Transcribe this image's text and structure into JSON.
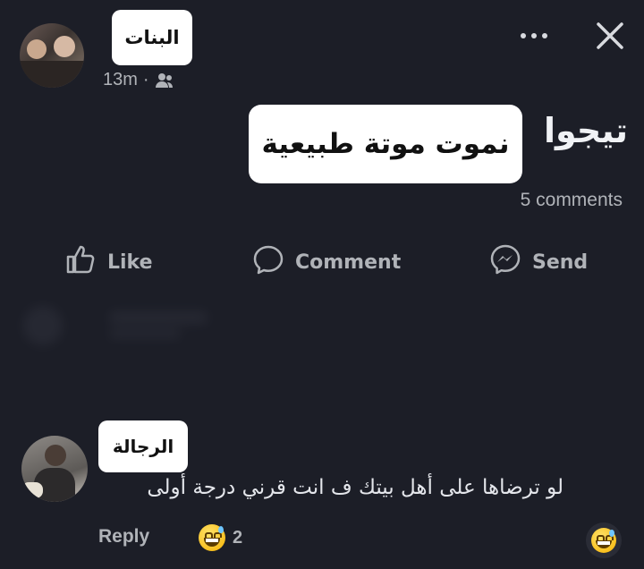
{
  "post": {
    "author_label": "البنات",
    "time": "13m",
    "separator": "·",
    "audience_icon": "friends-icon",
    "body_prefix": "تيجوا",
    "body_highlight": "نموت موتة طبيعية",
    "comments_count": "5 comments"
  },
  "header": {
    "more_icon": "more-dots-icon",
    "close_icon": "close-icon"
  },
  "actions": [
    {
      "label": "Like",
      "icon": "like-icon"
    },
    {
      "label": "Comment",
      "icon": "comment-icon"
    },
    {
      "label": "Send",
      "icon": "messenger-icon"
    }
  ],
  "comment": {
    "author_label": "الرجالة",
    "text": "لو ترضاها على أهل بيتك ف انت قرني درجة أولى",
    "reply_label": "Reply",
    "reaction_count": "2",
    "reaction_icon": "grinning-sweat-emoji"
  },
  "colors": {
    "background": "#1c1e27",
    "text": "#e4e6eb",
    "muted": "#b0b3b8"
  }
}
